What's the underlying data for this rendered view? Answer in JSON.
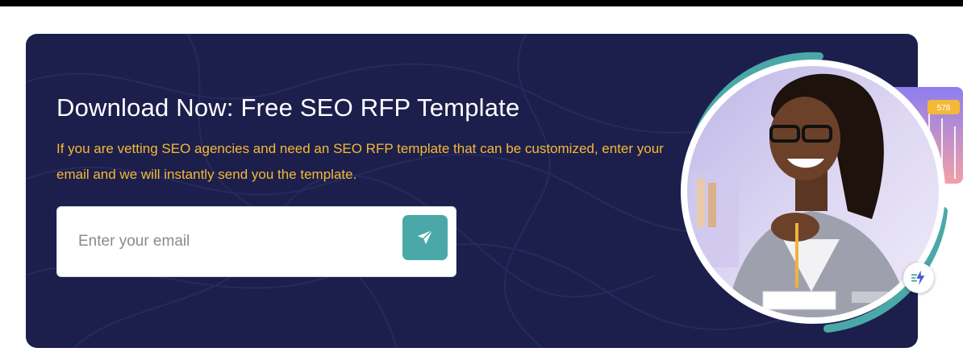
{
  "banner": {
    "title": "Download Now: Free SEO RFP Template",
    "description": "If you are vetting SEO agencies and need an SEO RFP template that can be customized, enter your email and we will instantly send you the template.",
    "email_placeholder": "Enter your email",
    "email_value": "",
    "send_icon": "paper-plane-icon",
    "chart_badge": "578"
  },
  "colors": {
    "banner_bg": "#1c1f4c",
    "title": "#ffffff",
    "description": "#f5b836",
    "accent_teal": "#4aa8a8"
  }
}
